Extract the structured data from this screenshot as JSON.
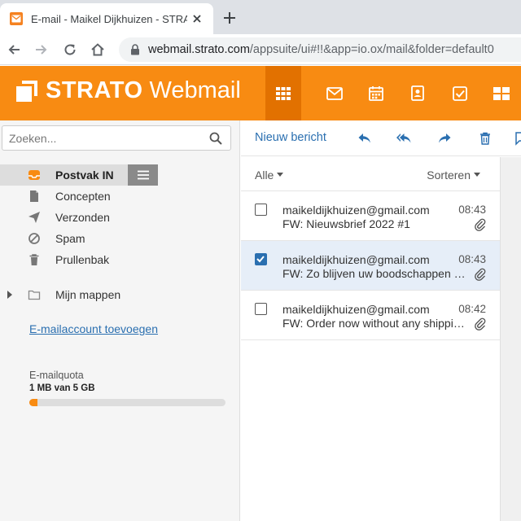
{
  "browser": {
    "tab_title": "E-mail - Maikel Dijkhuizen - STRATO",
    "url_host": "webmail.strato.com",
    "url_path": "/appsuite/ui#!!&app=io.ox/mail&folder=default0"
  },
  "app": {
    "brand": "STRATO",
    "product": "Webmail",
    "accent_color": "#f88b12",
    "header_icons": [
      "apps-grid-icon",
      "mail-icon",
      "calendar-icon",
      "contacts-icon",
      "tasks-icon",
      "drive-icon"
    ]
  },
  "sidebar": {
    "search_placeholder": "Zoeken...",
    "folders": [
      {
        "label": "Postvak IN",
        "icon": "inbox-icon",
        "selected": true
      },
      {
        "label": "Concepten",
        "icon": "drafts-icon"
      },
      {
        "label": "Verzonden",
        "icon": "sent-icon"
      },
      {
        "label": "Spam",
        "icon": "spam-icon"
      },
      {
        "label": "Prullenbak",
        "icon": "trash-icon"
      }
    ],
    "my_folders": "Mijn mappen",
    "add_account": "E-mailaccount toevoegen",
    "quota_label": "E-mailquota",
    "quota_value": "1 MB van 5 GB",
    "quota_fraction": 0.04
  },
  "toolbar": {
    "compose_label": "Nieuw bericht",
    "icons": [
      "reply-icon",
      "reply-all-icon",
      "forward-icon",
      "delete-icon"
    ]
  },
  "list": {
    "filter_label": "Alle",
    "sort_label": "Sorteren",
    "messages": [
      {
        "from": "maikeldijkhuizen@gmail.com",
        "subject": "FW: Nieuwsbrief 2022 #1",
        "time": "08:43",
        "checked": false,
        "attachment": true
      },
      {
        "from": "maikeldijkhuizen@gmail.com",
        "subject": "FW: Zo blijven uw boodschappen goedkoop",
        "time": "08:43",
        "checked": true,
        "attachment": true
      },
      {
        "from": "maikeldijkhuizen@gmail.com",
        "subject": "FW: Order now without any shipping costs",
        "time": "08:42",
        "checked": false,
        "attachment": true
      }
    ]
  }
}
